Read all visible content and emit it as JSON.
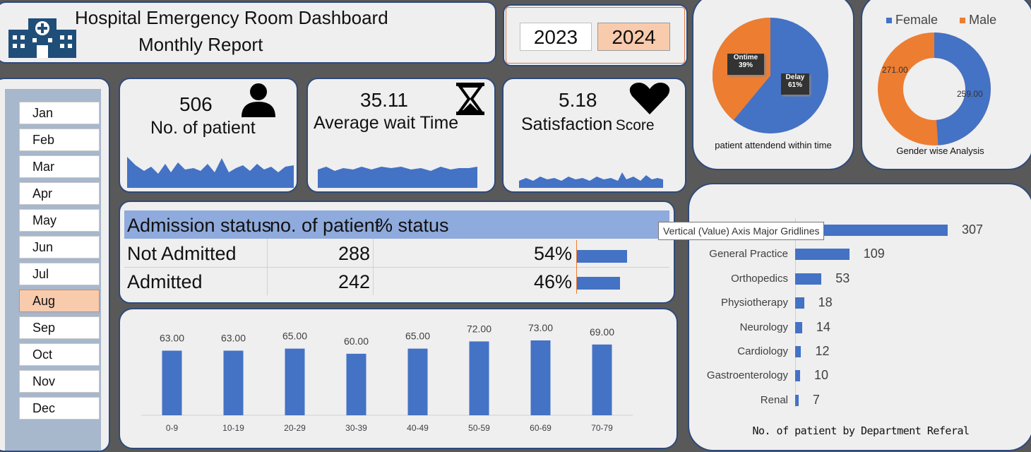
{
  "header": {
    "title_line1": "Hospital Emergency Room Dashboard",
    "title_line2": "Monthly  Report",
    "icon": "hospital-icon"
  },
  "years": {
    "items": [
      "2023",
      "2024"
    ],
    "selected": "2024"
  },
  "months": {
    "items": [
      "Jan",
      "Feb",
      "Mar",
      "Apr",
      "May",
      "Jun",
      "Jul",
      "Aug",
      "Sep",
      "Oct",
      "Nov",
      "Dec"
    ],
    "selected": "Aug"
  },
  "kpis": {
    "patients": {
      "value": "506",
      "label": "No. of patient",
      "icon": "person-icon"
    },
    "wait": {
      "value": "35.11",
      "label": "Average wait Time",
      "icon": "hourglass-icon"
    },
    "satisfaction": {
      "value": "5.18",
      "label_main": "Satisfaction",
      "label_sub": "Score",
      "icon": "heart-icon"
    }
  },
  "ontime_pie": {
    "caption": "patient attendend within time",
    "slices": [
      {
        "name": "Delay",
        "pct_label": "61%",
        "value": 61,
        "color": "#4472c4"
      },
      {
        "name": "Ontime",
        "pct_label": "39%",
        "value": 39,
        "color": "#ed7d31"
      }
    ]
  },
  "gender_donut": {
    "caption": "Gender wise Analysis",
    "legend": [
      {
        "name": "Female",
        "color": "#4472c4"
      },
      {
        "name": "Male",
        "color": "#ed7d31"
      }
    ],
    "values": {
      "female": 259,
      "male": 271
    },
    "female_label": "259.00",
    "male_label": "271.00"
  },
  "admission": {
    "headers": {
      "status": "Admission status",
      "count": "no. of patient",
      "pct": "% status"
    },
    "rows": [
      {
        "status": "Not Admitted",
        "count": "288",
        "pct": "54%",
        "fraction": 0.54
      },
      {
        "status": "Admitted",
        "count": "242",
        "pct": "46%",
        "fraction": 0.46
      }
    ]
  },
  "tooltip": "Vertical (Value) Axis Major Gridlines",
  "chart_data": [
    {
      "type": "bar",
      "categories": [
        "0-9",
        "10-19",
        "20-29",
        "30-39",
        "40-49",
        "50-59",
        "60-69",
        "70-79"
      ],
      "values": [
        63,
        63,
        65,
        60,
        65,
        72,
        73,
        69
      ],
      "labels": [
        "63.00",
        "63.00",
        "65.00",
        "60.00",
        "65.00",
        "72.00",
        "73.00",
        "69.00"
      ],
      "ylim": [
        0,
        73
      ]
    },
    {
      "type": "bar",
      "orientation": "horizontal",
      "title": "No. of patient by Department Referal",
      "categories": [
        "",
        "General Practice",
        "Orthopedics",
        "Physiotherapy",
        "Neurology",
        "Cardiology",
        "Gastroenterology",
        "Renal"
      ],
      "values": [
        307,
        109,
        53,
        18,
        14,
        12,
        10,
        7
      ]
    }
  ]
}
